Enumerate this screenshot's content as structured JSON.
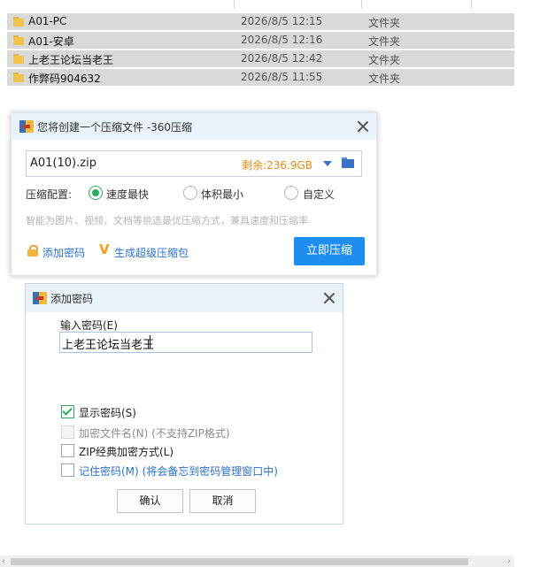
{
  "explorer": {
    "files": [
      {
        "name": "A01-PC",
        "date": "2026/8/5 12:15",
        "type": "文件夹"
      },
      {
        "name": "A01-安卓",
        "date": "2026/8/5 12:16",
        "type": "文件夹"
      },
      {
        "name": "上老王论坛当老王",
        "date": "2026/8/5 12:42",
        "type": "文件夹"
      },
      {
        "name": "作弊码904632",
        "date": "2026/8/5 11:55",
        "type": "文件夹"
      }
    ]
  },
  "compress_dialog": {
    "title": "您将创建一个压缩文件 -360压缩",
    "filename": "A01(10).zip",
    "free_space": "剩余:236.9GB",
    "config_label": "压缩配置:",
    "options": [
      "速度最快",
      "体积最小",
      "自定义"
    ],
    "selected_option": "速度最快",
    "hint": "智能为图片、视频、文档等挑选最优压缩方式，兼具速度和压缩率",
    "add_password_link": "添加密码",
    "super_package_link": "生成超级压缩包",
    "compress_button": "立即压缩"
  },
  "password_dialog": {
    "title": "添加密码",
    "input_label": "输入密码(E)",
    "password_value": "上老王论坛当老王",
    "checkboxes": {
      "show_password": {
        "label": "显示密码(S)",
        "checked": true
      },
      "encrypt_filenames": {
        "label": "加密文件名(N) (不支持ZIP格式)",
        "checked": false,
        "disabled": true
      },
      "zip_classic": {
        "label": "ZIP经典加密方式(L)",
        "checked": false
      },
      "remember_password": {
        "label": "记住密码(M) (将会备忘到密码管理窗口中)",
        "checked": false
      }
    },
    "ok_button": "确认",
    "cancel_button": "取消"
  },
  "colors": {
    "accent_blue": "#1e8df0",
    "link_blue": "#2b73c9",
    "free_space_orange": "#e58a1a",
    "check_green": "#2eaa62",
    "row_selected": "#d9d9d9"
  }
}
